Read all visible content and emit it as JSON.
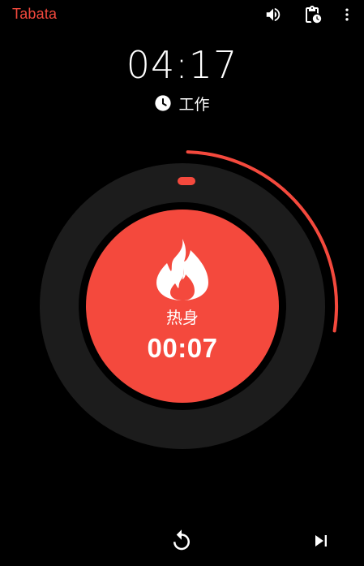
{
  "app": {
    "title": "Tabata",
    "accent_color": "#f4493d"
  },
  "toolbar": {
    "icons": [
      "volume-up-icon",
      "clipboard-clock-icon",
      "more-vert-icon"
    ]
  },
  "timer": {
    "total_remaining": "04:17",
    "next_phase_icon": "clock-icon",
    "next_phase_label": "工作",
    "progress_fraction": 0.27
  },
  "current_round": {
    "icon": "flame-icon",
    "label": "热身",
    "time": "00:07"
  },
  "controls": {
    "icons": [
      "replay-icon",
      "skip-next-icon"
    ]
  }
}
